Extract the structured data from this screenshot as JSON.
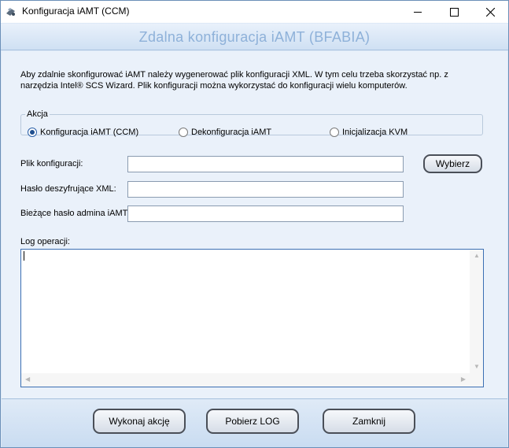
{
  "window": {
    "title": "Konfiguracja iAMT (CCM)",
    "header": "Zdalna konfiguracja iAMT (BFABIA)"
  },
  "intro_lines": [
    "Aby zdalnie skonfigurować iAMT należy wygenerować plik konfiguracji XML. W tym celu trzeba skorzystać np. z",
    "narzędzia Intel® SCS Wizard. Plik konfiguracji można wykorzystać do konfiguracji wielu komputerów."
  ],
  "akcja": {
    "legend": "Akcja",
    "options": [
      {
        "label": "Konfiguracja iAMT (CCM)",
        "selected": true
      },
      {
        "label": "Dekonfiguracja iAMT",
        "selected": false
      },
      {
        "label": "Inicjalizacja KVM",
        "selected": false
      }
    ]
  },
  "form": {
    "config_file_label": "Plik konfiguracji:",
    "config_file_value": "",
    "xml_password_label": "Hasło deszyfrujące XML:",
    "xml_password_value": "",
    "admin_password_label": "Bieżące hasło admina iAMT:",
    "admin_password_value": "",
    "browse_button": "Wybierz"
  },
  "log": {
    "label": "Log operacji:",
    "content": ""
  },
  "footer": {
    "execute_button": "Wykonaj akcję",
    "download_log_button": "Pobierz LOG",
    "close_button": "Zamknij"
  }
}
